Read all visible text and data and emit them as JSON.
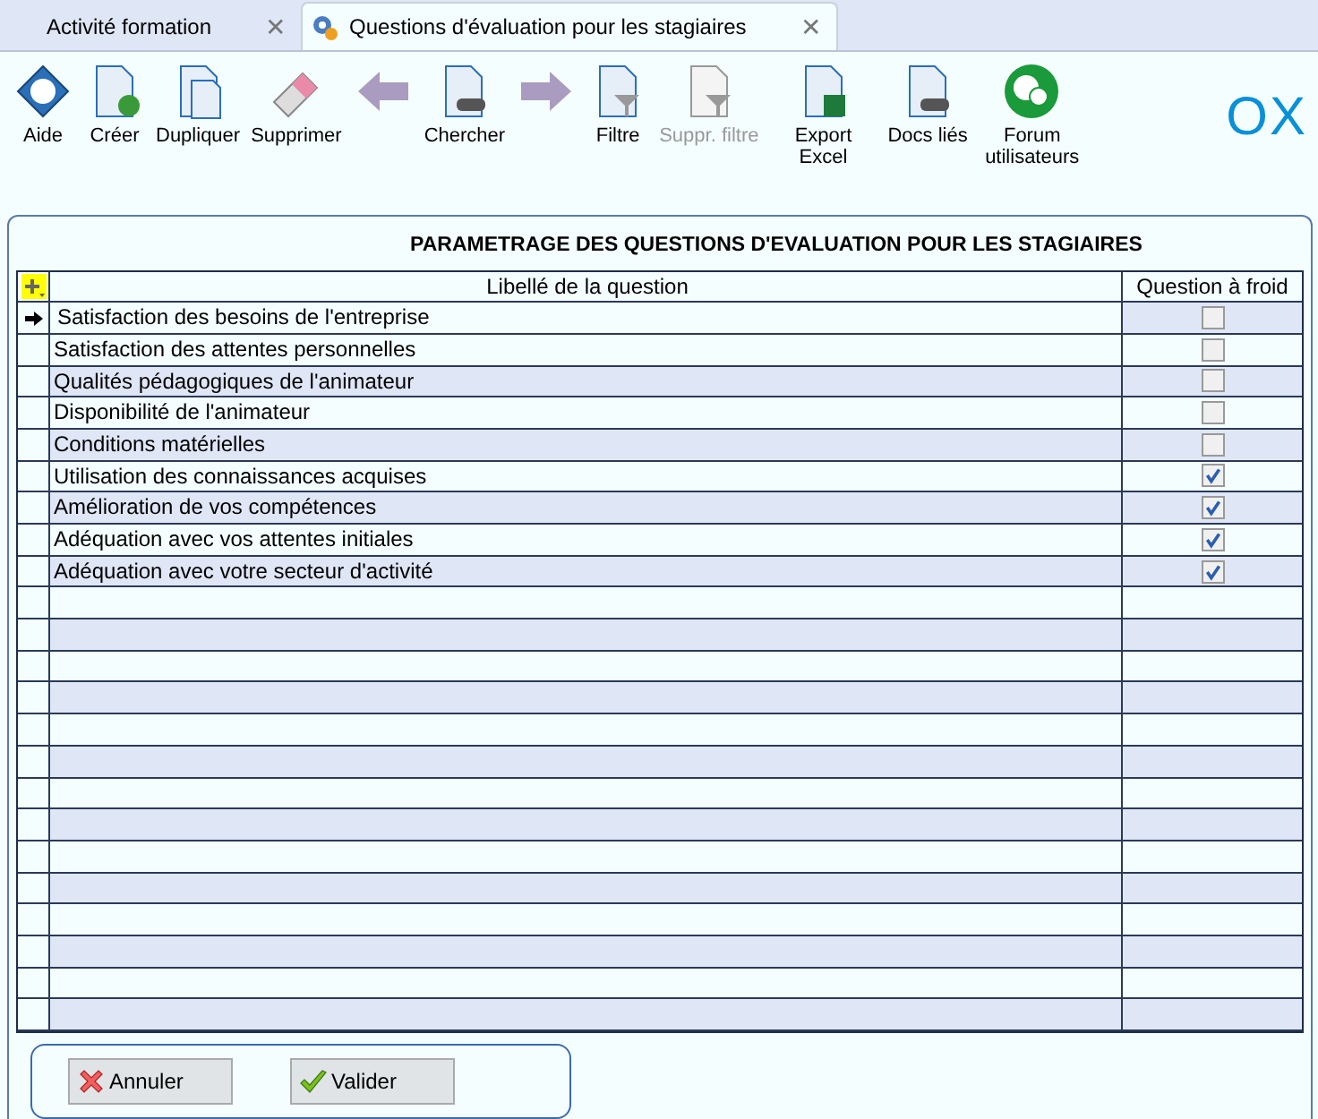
{
  "tabs": [
    {
      "label": "Activité formation",
      "selected": false,
      "close": "✕"
    },
    {
      "label": "Questions d'évaluation pour les stagiaires",
      "selected": true,
      "close": "✕"
    }
  ],
  "toolbar": [
    {
      "kind": "help",
      "label": "Aide",
      "disabled": false
    },
    {
      "kind": "new",
      "label": "Créer",
      "disabled": false
    },
    {
      "kind": "copy",
      "label": "Dupliquer",
      "disabled": false
    },
    {
      "kind": "eraser",
      "label": "Supprimer",
      "disabled": false
    },
    {
      "kind": "back",
      "disabled": false
    },
    {
      "kind": "search",
      "label": "Chercher",
      "disabled": false
    },
    {
      "kind": "forward",
      "disabled": false
    },
    {
      "kind": "filter",
      "label": "Filtre",
      "disabled": false
    },
    {
      "kind": "unfilter",
      "label": "Suppr. filtre",
      "disabled": true
    },
    {
      "kind": "excel",
      "label": "Export Excel",
      "disabled": false
    },
    {
      "kind": "docs",
      "label": "Docs liés",
      "disabled": false
    },
    {
      "kind": "forum",
      "label": "Forum utilisateurs",
      "disabled": false
    }
  ],
  "logo": "OX",
  "title": "PARAMETRAGE DES QUESTIONS D'EVALUATION POUR LES STAGIAIRES",
  "table": {
    "columns": [
      "Libellé de la question",
      "Question à froid"
    ],
    "rows": [
      {
        "question": "Satisfaction des besoins de l'entreprise",
        "cold": false,
        "current": true
      },
      {
        "question": "Satisfaction des attentes personnelles",
        "cold": false,
        "current": false
      },
      {
        "question": "Qualités pédagogiques de l'animateur",
        "cold": false,
        "current": false
      },
      {
        "question": "Disponibilité de l'animateur",
        "cold": false,
        "current": false
      },
      {
        "question": "Conditions matérielles",
        "cold": false,
        "current": false
      },
      {
        "question": "Utilisation des connaissances acquises",
        "cold": true,
        "current": false
      },
      {
        "question": "Amélioration de vos compétences",
        "cold": true,
        "current": false
      },
      {
        "question": "Adéquation avec vos attentes initiales",
        "cold": true,
        "current": false
      },
      {
        "question": "Adéquation avec votre secteur d'activité",
        "cold": true,
        "current": false
      }
    ]
  },
  "buttons": [
    {
      "kind": "cancel",
      "label": "Annuler"
    },
    {
      "kind": "ok",
      "label": "Valider"
    }
  ]
}
